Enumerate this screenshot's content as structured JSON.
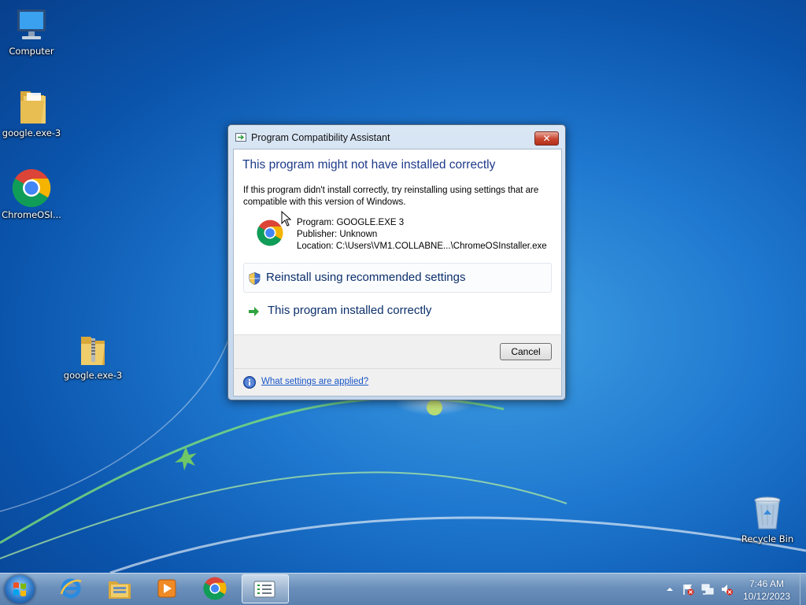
{
  "desktop": {
    "icons": [
      {
        "label": "Computer",
        "icon": "computer-icon"
      },
      {
        "label": "google.exe-3",
        "icon": "folder-icon"
      },
      {
        "label": "ChromeOSI...",
        "icon": "chrome-icon"
      },
      {
        "label": "google.exe-3",
        "icon": "zip-folder-icon"
      },
      {
        "label": "Recycle Bin",
        "icon": "recycle-bin-icon"
      }
    ]
  },
  "dialog": {
    "title": "Program Compatibility Assistant",
    "close_label": "✕",
    "heading": "This program might not have installed correctly",
    "description": "If this program didn't install correctly, try reinstalling using settings that are compatible with this version of Windows.",
    "program": "Program: GOOGLE.EXE 3",
    "publisher": "Publisher: Unknown",
    "location": "Location: C:\\Users\\VM1.COLLABNE...\\ChromeOSInstaller.exe",
    "option_reinstall": "Reinstall using recommended settings",
    "option_correct": "This program installed correctly",
    "cancel_label": "Cancel",
    "help_link": "What settings are applied?"
  },
  "taskbar": {
    "pinned": [
      "internet-explorer-icon",
      "windows-explorer-icon",
      "media-player-icon",
      "chrome-icon",
      "compatibility-assistant-icon"
    ],
    "clock_time": "7:46 AM",
    "clock_date": "10/12/2023"
  },
  "colors": {
    "heading": "#1e3a8a",
    "link": "#1a56c7",
    "desktop_bg": "#1f78cf"
  }
}
